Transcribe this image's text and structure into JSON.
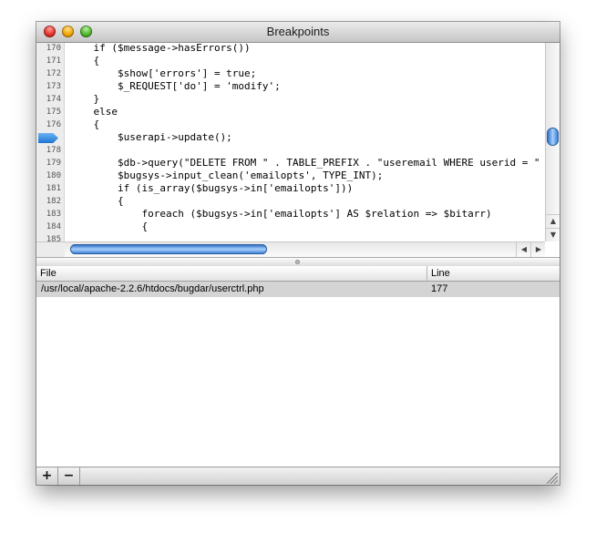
{
  "window": {
    "title": "Breakpoints"
  },
  "editor": {
    "breakpoint_line": "177",
    "lines": [
      {
        "num": "170",
        "text": "    if ($message->hasErrors())"
      },
      {
        "num": "171",
        "text": "    {"
      },
      {
        "num": "172",
        "text": "        $show['errors'] = true;"
      },
      {
        "num": "173",
        "text": "        $_REQUEST['do'] = 'modify';"
      },
      {
        "num": "174",
        "text": "    }"
      },
      {
        "num": "175",
        "text": "    else"
      },
      {
        "num": "176",
        "text": "    {"
      },
      {
        "num": "177",
        "text": "        $userapi->update();"
      },
      {
        "num": "178",
        "text": ""
      },
      {
        "num": "179",
        "text": "        $db->query(\"DELETE FROM \" . TABLE_PREFIX . \"useremail WHERE userid = \" . $bugs"
      },
      {
        "num": "180",
        "text": "        $bugsys->input_clean('emailopts', TYPE_INT);"
      },
      {
        "num": "181",
        "text": "        if (is_array($bugsys->in['emailopts']))"
      },
      {
        "num": "182",
        "text": "        {"
      },
      {
        "num": "183",
        "text": "            foreach ($bugsys->in['emailopts'] AS $relation => $bitarr)"
      },
      {
        "num": "184",
        "text": "            {"
      },
      {
        "num": "185",
        "text": ""
      }
    ]
  },
  "table": {
    "columns": {
      "file": "File",
      "line": "Line"
    },
    "rows": [
      {
        "file": "/usr/local/apache-2.2.6/htdocs/bugdar/userctrl.php",
        "line": "177"
      }
    ]
  },
  "bottombar": {
    "add_label": "+",
    "remove_label": "−"
  },
  "icons": {
    "close": "close-button-icon",
    "minimize": "minimize-button-icon",
    "zoom": "zoom-button-icon",
    "scroll_up": "▲",
    "scroll_down": "▼",
    "scroll_left": "◀",
    "scroll_right": "▶"
  }
}
